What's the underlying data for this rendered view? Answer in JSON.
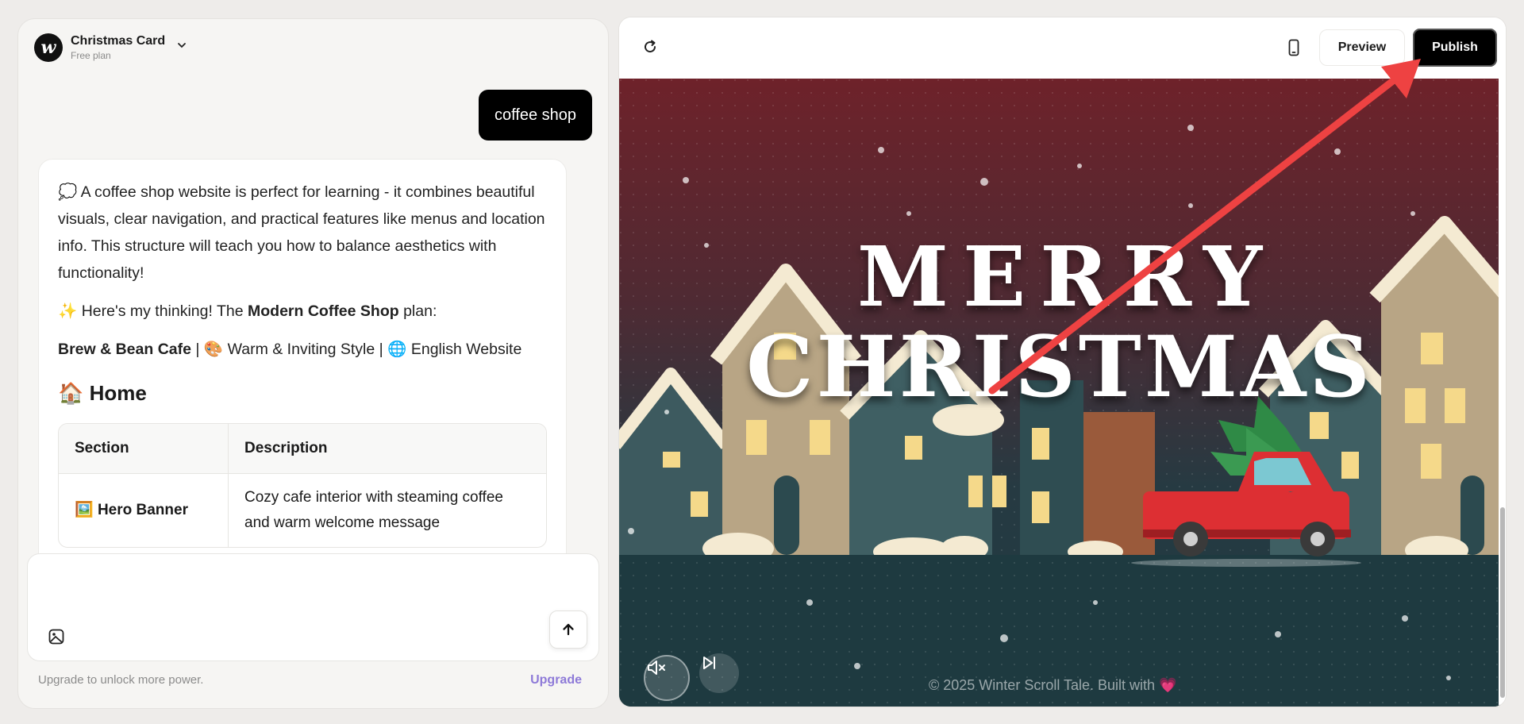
{
  "project": {
    "logo_letter": "w",
    "title": "Christmas Card",
    "plan": "Free plan"
  },
  "chat": {
    "user_message": "coffee shop",
    "ai": {
      "intro_emoji": "💭",
      "intro": "A coffee shop website is perfect for learning - it combines beautiful visuals, clear navigation, and practical features like menus and location info. This structure will teach you how to balance aesthetics with functionality!",
      "thinking_emoji": "✨",
      "thinking_prefix": "Here's my thinking! The ",
      "thinking_plan": "Modern Coffee Shop",
      "thinking_suffix": " plan:",
      "site_name": "Brew & Bean Cafe",
      "sep1": " | ",
      "style_emoji": "🎨",
      "style": "Warm & Inviting Style",
      "sep2": " | ",
      "lang_emoji": "🌐",
      "language": "English Website",
      "home_emoji": "🏠",
      "home_heading": "Home",
      "table": {
        "headers": [
          "Section",
          "Description"
        ],
        "rows": [
          {
            "emoji": "🖼️",
            "section": "Hero Banner",
            "description": "Cozy cafe interior with steaming coffee and warm welcome message"
          }
        ]
      }
    }
  },
  "input": {
    "placeholder": ""
  },
  "footer": {
    "note": "Upgrade to unlock more power.",
    "upgrade_label": "Upgrade"
  },
  "toolbar": {
    "preview_label": "Preview",
    "publish_label": "Publish"
  },
  "preview": {
    "title_line1": "MERRY",
    "title_line2": "CHRISTMAS",
    "copyright": "© 2025 Winter Scroll Tale. Built with ",
    "heart": "💗"
  },
  "colors": {
    "sky_top": "#6e222a",
    "sky_bottom": "#203c42",
    "ground": "#1e3a40",
    "truck": "#dd2f33",
    "tree": "#2f8a46",
    "arrow": "#ee4242",
    "upgrade": "#8e7ad8"
  }
}
